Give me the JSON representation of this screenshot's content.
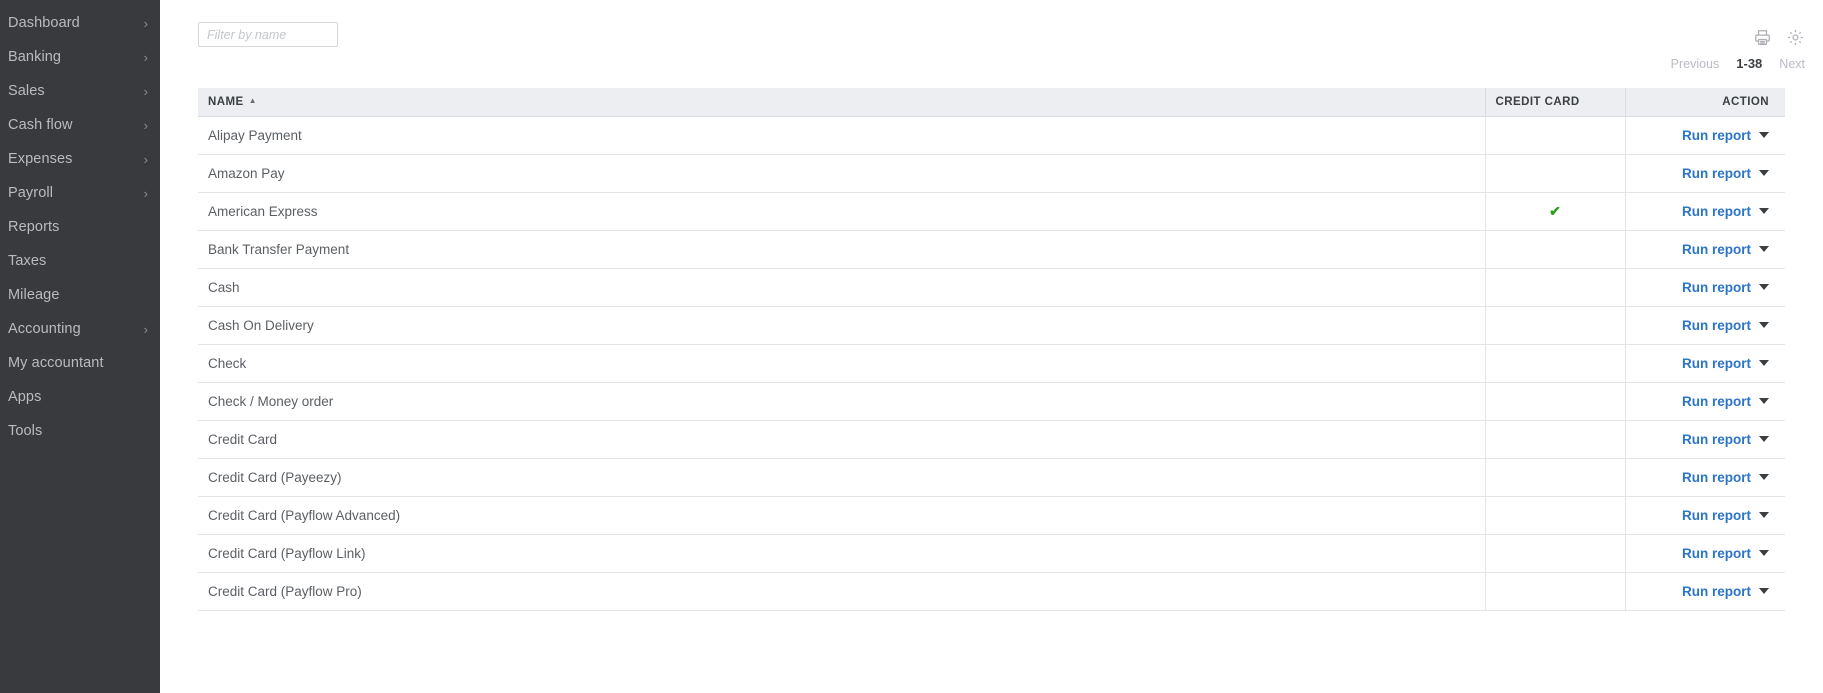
{
  "sidebar": {
    "background": "#393A3D",
    "items": [
      {
        "label": "Dashboard",
        "has_chevron": true
      },
      {
        "label": "Banking",
        "has_chevron": true
      },
      {
        "label": "Sales",
        "has_chevron": true
      },
      {
        "label": "Cash flow",
        "has_chevron": true
      },
      {
        "label": "Expenses",
        "has_chevron": true
      },
      {
        "label": "Payroll",
        "has_chevron": true
      },
      {
        "label": "Reports",
        "has_chevron": false
      },
      {
        "label": "Taxes",
        "has_chevron": false
      },
      {
        "label": "Mileage",
        "has_chevron": false
      },
      {
        "label": "Accounting",
        "has_chevron": true
      },
      {
        "label": "My accountant",
        "has_chevron": false
      },
      {
        "label": "Apps",
        "has_chevron": false
      },
      {
        "label": "Tools",
        "has_chevron": false
      }
    ],
    "chevron_glyph": "›"
  },
  "toolbar": {
    "filter": {
      "value": "",
      "placeholder": "Filter by name"
    },
    "print_icon": "printer-icon",
    "settings_icon": "gear-icon"
  },
  "pagination": {
    "previous_label": "Previous",
    "range_label": "1-38",
    "next_label": "Next"
  },
  "table": {
    "columns": [
      {
        "key": "name",
        "label": "NAME",
        "sorted": true,
        "sort_direction": "asc",
        "sort_glyph": "▲"
      },
      {
        "key": "credit",
        "label": "CREDIT CARD",
        "sorted": false
      },
      {
        "key": "action",
        "label": "ACTION",
        "sorted": false
      }
    ],
    "action_label": "Run report",
    "check_glyph": "✔",
    "check_color": "#2CA01C",
    "link_color": "#2C74C8",
    "rows": [
      {
        "name": "Alipay Payment",
        "credit_card": false
      },
      {
        "name": "Amazon Pay",
        "credit_card": false
      },
      {
        "name": "American Express",
        "credit_card": true
      },
      {
        "name": "Bank Transfer Payment",
        "credit_card": false
      },
      {
        "name": "Cash",
        "credit_card": false
      },
      {
        "name": "Cash On Delivery",
        "credit_card": false
      },
      {
        "name": "Check",
        "credit_card": false
      },
      {
        "name": "Check / Money order",
        "credit_card": false
      },
      {
        "name": "Credit Card",
        "credit_card": false
      },
      {
        "name": "Credit Card (Payeezy)",
        "credit_card": false
      },
      {
        "name": "Credit Card (Payflow Advanced)",
        "credit_card": false
      },
      {
        "name": "Credit Card (Payflow Link)",
        "credit_card": false
      },
      {
        "name": "Credit Card (Payflow Pro)",
        "credit_card": false
      }
    ]
  }
}
